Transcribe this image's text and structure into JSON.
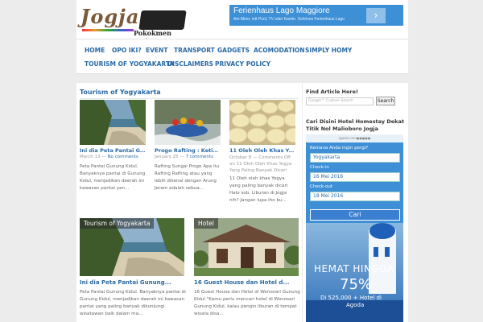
{
  "header": {
    "logo_text": "Jogja",
    "logo_tagline": "Pokokmen Jogja og"
  },
  "ad": {
    "title": "Ferienhaus Lago Maggiore",
    "subtitle": "Am Meer, mit Pool, TV oder Kamin. Schönes Ferienhaus Lago",
    "arrow": "›",
    "dots": "○ ○"
  },
  "nav": {
    "items": [
      "HOME",
      "OPO IKI?",
      "EVENT",
      "TRANSPORT",
      "GADGETS",
      "ACOMODATION",
      "SIMPLY HOMY",
      "TOURISM OF YOGYAKARTA",
      "DISCLAIMERS",
      "PRIVACY POLICY"
    ]
  },
  "main": {
    "section_title": "Tourism of Yogyakarta",
    "cards": [
      {
        "title": "Ini dia Peta Pantai Gu...",
        "date": "March 13",
        "sep": "—",
        "comments": "No comments",
        "excerpt": "Peta Pantai Gunung Kidul. Banyaknya pantai di Gunung Kidul, menjadikan daerah ini kawasan pantai yan..."
      },
      {
        "title": "Progo Rafting : Ketika...",
        "date": "January 25",
        "sep": "—",
        "comments": "7 comments",
        "excerpt": "Rafting Sungai Progo Apa itu Rafting Rafting atau yang lebih dikenal dengan Arung Jeram adalah sebua..."
      },
      {
        "title": "11 Oleh Oleh Khas Yogy...",
        "date": "October 8",
        "sep": "—",
        "comments": "Comments Off on 11 Oleh Oleh Khas Yogya Yang Paling Banyak Dicari",
        "excerpt": "11 Oleh oleh khas Yogya yang paling banyak dicari Halo sob, Liburan di Jogja nih? Jangan lupa iho bu..."
      }
    ],
    "big_cards": [
      {
        "label": "Tourism of Yogyakarta",
        "title": "Ini dia Peta Pantai Gunung...",
        "excerpt": "Peta Pantai Gunung Kidul. Banyaknya pantai di Gunung Kidul, menjadikan daerah ini kawasan pantai yang paling banyak dikunjungi wisatawan baik dalam ma..."
      },
      {
        "label": "Hotel",
        "title": "16 Guest House dan Hotel d...",
        "excerpt": "16 Guest House dan Hotel di Wonosari Gunung Kidul \"Kamu perlu mencari hotel di Wonosari Gunung Kidul, kalau pengin liburan di tempat wisata disa..."
      }
    ]
  },
  "sidebar": {
    "find_title": "Find Article Here!",
    "search_placeholder": "Google™ Custom Search",
    "search_button": "Search",
    "hotel_title": "Cari Disini Hotel Homestay Dekat Titik Nol Malioboro Jogja",
    "agoda_logo": "agoda.com●●●●●",
    "dest_label": "Kemana Anda ingin pergi?",
    "dest_value": "Yogyakarta",
    "checkin_label": "Check-in",
    "checkin_value": "16 Mei 2016",
    "checkout_label": "Check-out",
    "checkout_value": "18 Mei 2016",
    "cari_button": "Cari",
    "promo_heading": "HEMAT HINGGA",
    "promo_number": "75%",
    "promo_detail": "Di 525,000 + Hotel di",
    "promo_brand": "Agoda"
  }
}
